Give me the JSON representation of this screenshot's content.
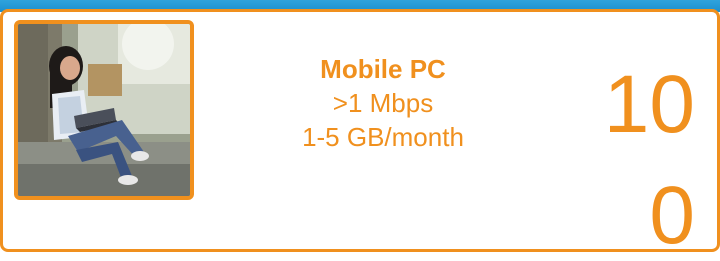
{
  "card": {
    "title": "Mobile PC",
    "speed": ">1 Mbps",
    "usage": "1-5 GB/month",
    "value_line1": "10",
    "value_line2": "0"
  },
  "colors": {
    "accent": "#f0901e",
    "topbar": "#1c8fcf"
  },
  "photo": {
    "subject": "girl-with-laptop"
  }
}
